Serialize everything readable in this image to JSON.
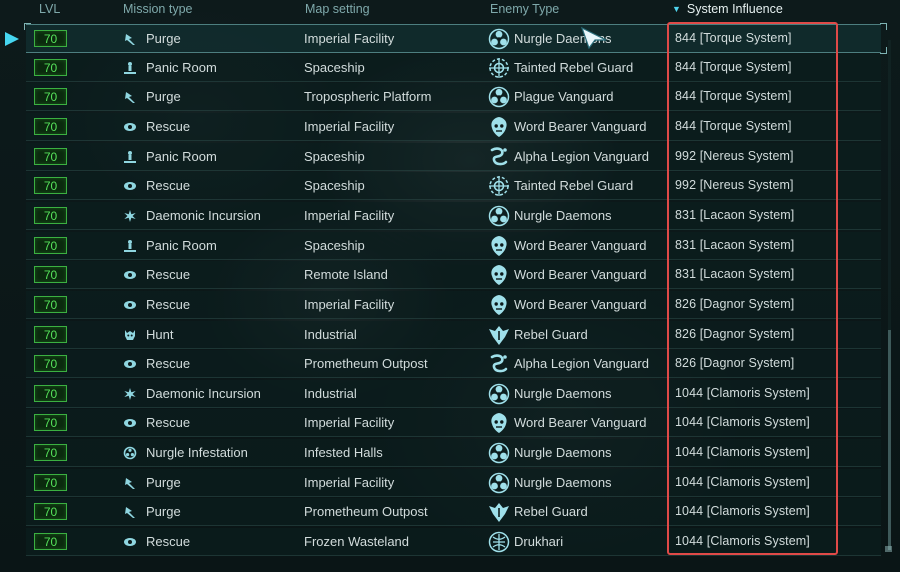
{
  "header": {
    "lvl": "LVL",
    "mission_type": "Mission type",
    "map_setting": "Map setting",
    "enemy_type": "Enemy Type",
    "system_influence": "System Influence"
  },
  "colors": {
    "level_badge": "#56e35b",
    "accent": "#46d6f0",
    "highlight_box": "#e04a48"
  },
  "missions": [
    {
      "level": "70",
      "mission": "Purge",
      "mission_icon": "purge-icon",
      "map": "Imperial Facility",
      "enemy": "Nurgle Daemons",
      "enemy_icon": "nurgle-icon",
      "influence": "844 [Torque System]",
      "selected": true
    },
    {
      "level": "70",
      "mission": "Panic Room",
      "mission_icon": "panic-room-icon",
      "map": "Spaceship",
      "enemy": "Tainted Rebel Guard",
      "enemy_icon": "tainted-guard-icon",
      "influence": "844 [Torque System]"
    },
    {
      "level": "70",
      "mission": "Purge",
      "mission_icon": "purge-icon",
      "map": "Tropospheric Platform",
      "enemy": "Plague Vanguard",
      "enemy_icon": "nurgle-icon",
      "influence": "844 [Torque System]"
    },
    {
      "level": "70",
      "mission": "Rescue",
      "mission_icon": "rescue-icon",
      "map": "Imperial Facility",
      "enemy": "Word Bearer Vanguard",
      "enemy_icon": "word-bearer-icon",
      "influence": "844 [Torque System]"
    },
    {
      "level": "70",
      "mission": "Panic Room",
      "mission_icon": "panic-room-icon",
      "map": "Spaceship",
      "enemy": "Alpha Legion Vanguard",
      "enemy_icon": "alpha-legion-icon",
      "influence": "992 [Nereus System]"
    },
    {
      "level": "70",
      "mission": "Rescue",
      "mission_icon": "rescue-icon",
      "map": "Spaceship",
      "enemy": "Tainted Rebel Guard",
      "enemy_icon": "tainted-guard-icon",
      "influence": "992 [Nereus System]"
    },
    {
      "level": "70",
      "mission": "Daemonic Incursion",
      "mission_icon": "daemonic-incursion-icon",
      "map": "Imperial Facility",
      "enemy": "Nurgle Daemons",
      "enemy_icon": "nurgle-icon",
      "influence": "831 [Lacaon System]"
    },
    {
      "level": "70",
      "mission": "Panic Room",
      "mission_icon": "panic-room-icon",
      "map": "Spaceship",
      "enemy": "Word Bearer Vanguard",
      "enemy_icon": "word-bearer-icon",
      "influence": "831 [Lacaon System]"
    },
    {
      "level": "70",
      "mission": "Rescue",
      "mission_icon": "rescue-icon",
      "map": "Remote Island",
      "enemy": "Word Bearer Vanguard",
      "enemy_icon": "word-bearer-icon",
      "influence": "831 [Lacaon System]"
    },
    {
      "level": "70",
      "mission": "Rescue",
      "mission_icon": "rescue-icon",
      "map": "Imperial Facility",
      "enemy": "Word Bearer Vanguard",
      "enemy_icon": "word-bearer-icon",
      "influence": "826 [Dagnor System]"
    },
    {
      "level": "70",
      "mission": "Hunt",
      "mission_icon": "hunt-icon",
      "map": "Industrial",
      "enemy": "Rebel Guard",
      "enemy_icon": "rebel-guard-icon",
      "influence": "826 [Dagnor System]"
    },
    {
      "level": "70",
      "mission": "Rescue",
      "mission_icon": "rescue-icon",
      "map": "Prometheum Outpost",
      "enemy": "Alpha Legion Vanguard",
      "enemy_icon": "alpha-legion-icon",
      "influence": "826 [Dagnor System]"
    },
    {
      "level": "70",
      "mission": "Daemonic Incursion",
      "mission_icon": "daemonic-incursion-icon",
      "map": "Industrial",
      "enemy": "Nurgle Daemons",
      "enemy_icon": "nurgle-icon",
      "influence": "1044 [Clamoris System]"
    },
    {
      "level": "70",
      "mission": "Rescue",
      "mission_icon": "rescue-icon",
      "map": "Imperial Facility",
      "enemy": "Word Bearer Vanguard",
      "enemy_icon": "word-bearer-icon",
      "influence": "1044 [Clamoris System]"
    },
    {
      "level": "70",
      "mission": "Nurgle Infestation",
      "mission_icon": "nurgle-infestation-icon",
      "map": "Infested Halls",
      "enemy": "Nurgle Daemons",
      "enemy_icon": "nurgle-icon",
      "influence": "1044 [Clamoris System]"
    },
    {
      "level": "70",
      "mission": "Purge",
      "mission_icon": "purge-icon",
      "map": "Imperial Facility",
      "enemy": "Nurgle Daemons",
      "enemy_icon": "nurgle-icon",
      "influence": "1044 [Clamoris System]"
    },
    {
      "level": "70",
      "mission": "Purge",
      "mission_icon": "purge-icon",
      "map": "Prometheum Outpost",
      "enemy": "Rebel Guard",
      "enemy_icon": "rebel-guard-icon",
      "influence": "1044 [Clamoris System]"
    },
    {
      "level": "70",
      "mission": "Rescue",
      "mission_icon": "rescue-icon",
      "map": "Frozen Wasteland",
      "enemy": "Drukhari",
      "enemy_icon": "drukhari-icon",
      "influence": "1044 [Clamoris System]"
    }
  ]
}
